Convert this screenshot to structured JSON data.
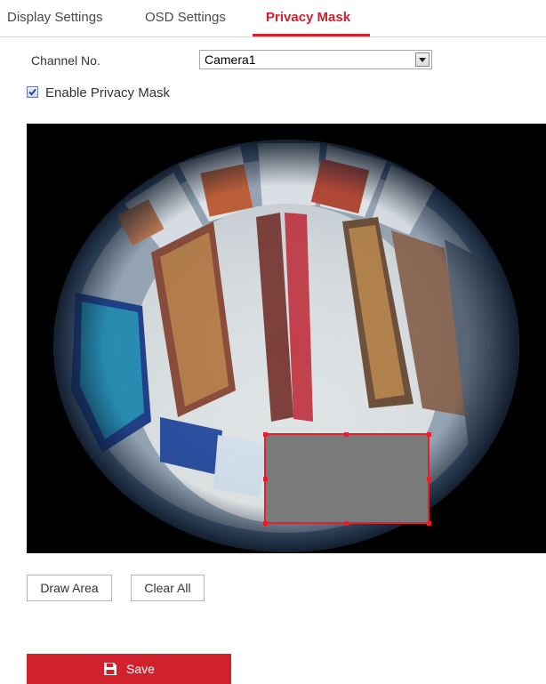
{
  "tabs": [
    {
      "label": "Display Settings",
      "active": false
    },
    {
      "label": "OSD Settings",
      "active": false
    },
    {
      "label": "Privacy Mask",
      "active": true
    }
  ],
  "form": {
    "channel_label": "Channel No.",
    "channel_value": "Camera1",
    "enable_label": "Enable Privacy Mask",
    "enable_checked": true
  },
  "video": {
    "mask_color": "#7a7a7a",
    "mask_border_color": "#e0202a"
  },
  "buttons": {
    "draw_area": "Draw Area",
    "clear_all": "Clear All",
    "save": "Save"
  },
  "colors": {
    "accent": "#d0212c"
  }
}
